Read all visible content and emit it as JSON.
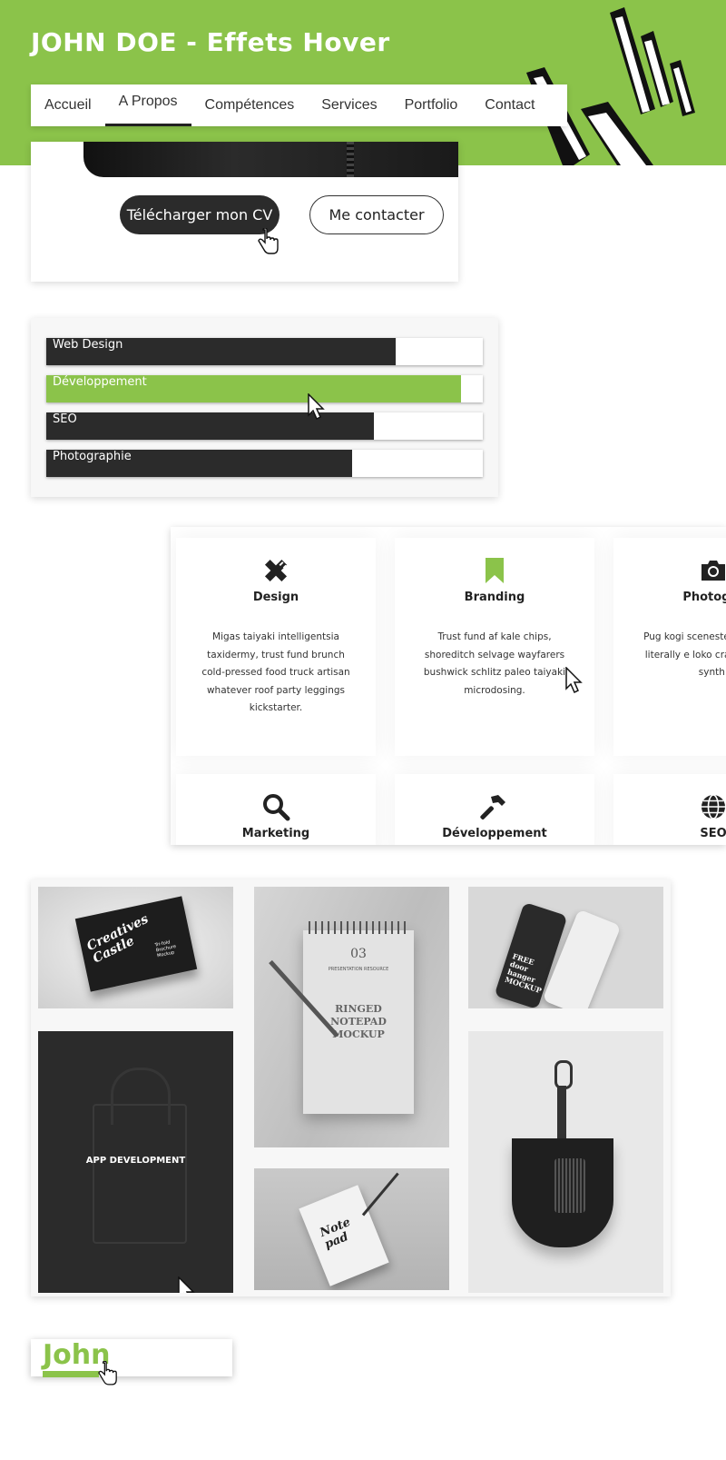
{
  "header": {
    "title": "JOHN DOE - Effets Hover",
    "background_color": "#8bc34a"
  },
  "nav": {
    "items": [
      {
        "label": "Accueil"
      },
      {
        "label": "A Propos",
        "active": true
      },
      {
        "label": "Compétences"
      },
      {
        "label": "Services"
      },
      {
        "label": "Portfolio"
      },
      {
        "label": "Contact"
      }
    ]
  },
  "hero_card": {
    "download_cv_label": "Télécharger mon CV",
    "contact_label": "Me contacter"
  },
  "skills": [
    {
      "label": "Web Design",
      "percent": 80
    },
    {
      "label": "Développement",
      "percent": 95,
      "hovered": true
    },
    {
      "label": "SEO",
      "percent": 75
    },
    {
      "label": "Photographie",
      "percent": 70
    }
  ],
  "services": [
    {
      "title": "Design",
      "icon": "pencil-ruler-icon",
      "text": "Migas taiyaki intelligentsia taxidermy, trust fund brunch cold-pressed food truck artisan whatever roof party leggings kickstarter."
    },
    {
      "title": "Branding",
      "icon": "bookmark-icon",
      "text": "Trust fund af kale chips, shoreditch selvage wayfarers bushwick schlitz paleo taiyaki microdosing."
    },
    {
      "title": "Photogra",
      "icon": "camera-icon",
      "text": "Pug kogi scenester cred retro literally e loko cray shabby c synth."
    },
    {
      "title": "Marketing",
      "icon": "search-icon"
    },
    {
      "title": "Développement",
      "icon": "hammer-icon"
    },
    {
      "title": "SEO",
      "icon": "globe-icon"
    }
  ],
  "portfolio": {
    "overlay_label": "APP DEVELOPMENT",
    "notepad_number": "03",
    "notepad_caption": "PRESENTATION RESOURCE",
    "notepad_title": "RINGED NOTEPAD MOCKUP",
    "brochure_text": "Creatives Castle",
    "brochure_sub": "Tri-fold Brochure Mockup",
    "hanger_text": "FREE door hanger MOCKUP",
    "notepad2_text": "Note pad"
  },
  "logo": {
    "text": "John",
    "accent_color": "#8bc34a"
  }
}
